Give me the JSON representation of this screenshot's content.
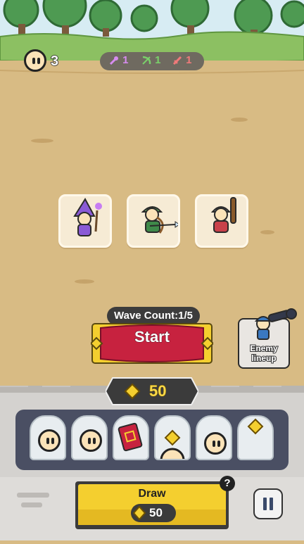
{
  "hud": {
    "coins": "3",
    "classes": [
      {
        "name": "mage",
        "count": "1",
        "color": "#d78cf0",
        "icon": "wand-icon"
      },
      {
        "name": "archer",
        "count": "1",
        "color": "#7ad06a",
        "icon": "bow-icon"
      },
      {
        "name": "warrior",
        "count": "1",
        "color": "#f07a7a",
        "icon": "sword-icon"
      }
    ]
  },
  "heroes": [
    {
      "name": "wizard",
      "icon": "wizard-hero-icon"
    },
    {
      "name": "archer",
      "icon": "archer-hero-icon"
    },
    {
      "name": "warrior",
      "icon": "warrior-hero-icon"
    }
  ],
  "wave": {
    "label": "Wave Count:1/5",
    "current": 1,
    "total": 5,
    "start_label": "Start"
  },
  "enemy_button": {
    "label_line1": "Enemy",
    "label_line2": "lineup"
  },
  "gems": {
    "count": "50"
  },
  "slots": [
    {
      "type": "hero-face",
      "icon": "face-icon"
    },
    {
      "type": "hero-face",
      "icon": "face-icon"
    },
    {
      "type": "card",
      "icon": "red-card-icon"
    },
    {
      "type": "gem-and-face",
      "icon": "gem-icon"
    },
    {
      "type": "hero-face",
      "icon": "face-icon"
    },
    {
      "type": "gem",
      "icon": "gem-icon"
    }
  ],
  "draw": {
    "label": "Draw",
    "cost": "50"
  },
  "help": {
    "label": "?"
  },
  "colors": {
    "start_red": "#c7223f",
    "gold": "#f4cf2f",
    "ground": "#d8bb84",
    "grass": "#8cc062"
  }
}
